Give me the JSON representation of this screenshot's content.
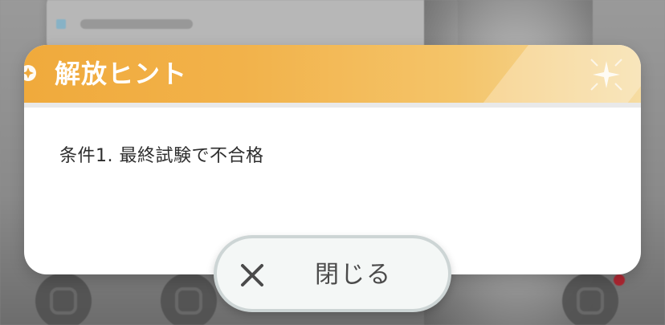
{
  "modal": {
    "title": "解放ヒント",
    "condition_text": "条件1.  最終試験で不合格"
  },
  "close_button": {
    "label": "閉じる",
    "icon": "close-icon"
  },
  "colors": {
    "header_gradient_start": "#f0aa3c",
    "header_gradient_end": "#f6dca2",
    "title_text": "#ffffff",
    "body_text": "#2d2d2d",
    "button_bg": "#f4f7f6",
    "button_border": "#cdd5d5"
  }
}
